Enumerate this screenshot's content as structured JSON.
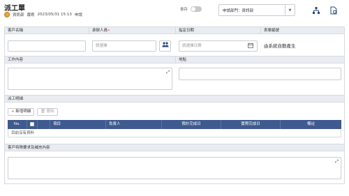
{
  "header": {
    "title": "派工單",
    "department": "資訊部",
    "user": "蕭宥",
    "datetime": "2023/05/31 15:13",
    "status": "申請",
    "toggle_label": "會存",
    "dept_select_value": "申請部門：資訊部"
  },
  "form": {
    "customer_name_label": "客戶名稱",
    "assignee_label": "承辦人員",
    "assignee_placeholder": "請選擇",
    "date_label": "指定日期",
    "date_placeholder": "請選擇日期",
    "form_no_label": "表單編號",
    "form_no_value": "由系統自動產生",
    "work_content_label": "工作內容",
    "location_label": "地點",
    "detail_label": "派工明細",
    "add_detail_button": "新增明細",
    "delete_button": "刪除",
    "table_columns": [
      "No.",
      "",
      "",
      "項目",
      "負責人",
      "預計完成日",
      "實際完成日",
      "備註"
    ],
    "empty_text": "目前沒有資料",
    "special_request_label": "客戶特殊要求及補充內容"
  },
  "icons": {
    "org_chart": "org-chart-icon",
    "export": "export-doc-icon",
    "users": "users-icon",
    "calendar": "calendar-icon",
    "expand": "expand-icon",
    "trash": "trash-icon",
    "plus": "plus-icon"
  },
  "colors": {
    "table_header": "#3e5a8e",
    "section_header": "#e9ecf1",
    "accent_orange": "#e07a1f",
    "required": "#dd3333"
  }
}
